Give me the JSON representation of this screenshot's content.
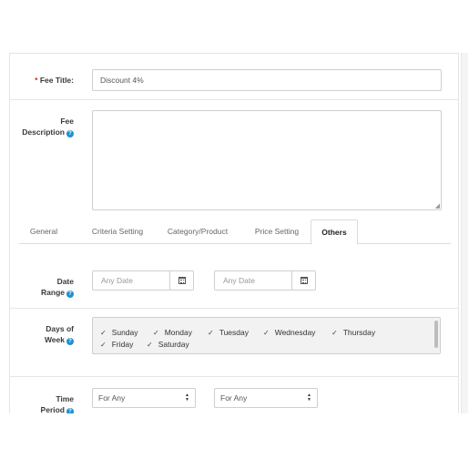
{
  "fee_title": {
    "label": "Fee Title:",
    "required_mark": "*",
    "value": "Discount 4%"
  },
  "fee_description": {
    "label_line1": "Fee",
    "label_line2": "Description",
    "value": ""
  },
  "tabs": [
    {
      "label": "General",
      "active": false
    },
    {
      "label": "Criteria Setting",
      "active": false
    },
    {
      "label": "Category/Product",
      "active": false
    },
    {
      "label": "Price Setting",
      "active": false
    },
    {
      "label": "Others",
      "active": true
    }
  ],
  "date_range": {
    "label_line1": "Date",
    "label_line2": "Range",
    "start_placeholder": "Any Date",
    "end_placeholder": "Any Date"
  },
  "days_of_week": {
    "label_line1": "Days of",
    "label_line2": "Week",
    "check_glyph": "✓",
    "days": [
      "Sunday",
      "Monday",
      "Tuesday",
      "Wednesday",
      "Thursday",
      "Friday",
      "Saturday"
    ],
    "checked": [
      true,
      true,
      true,
      true,
      true,
      true,
      true
    ]
  },
  "time_period": {
    "label_line1": "Time",
    "label_line2": "Period",
    "from_value": "For Any",
    "to_value": "For Any"
  },
  "icons": {
    "help": "question-circle-icon",
    "calendar": "calendar-icon",
    "select_arrows": "sort-arrows-icon"
  },
  "colors": {
    "required": "#e0281c",
    "help_icon": "#1e91cf",
    "days_box_bg": "#f2f2f2"
  }
}
